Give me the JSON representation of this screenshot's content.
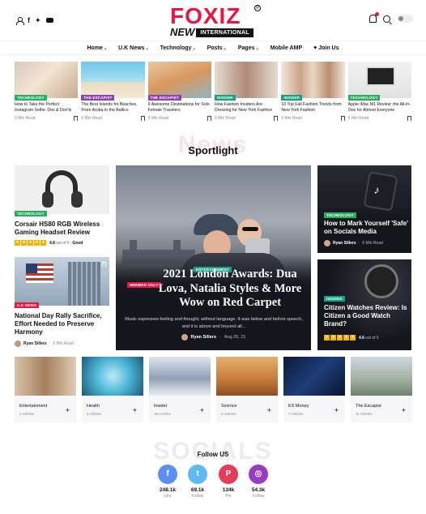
{
  "header": {
    "logo_main": "FOXIZ",
    "logo_new": "NEW",
    "logo_international": "INTERNATIONAL",
    "social_icons": [
      "facebook-icon",
      "twitter-icon",
      "youtube-icon"
    ]
  },
  "nav": [
    {
      "label": "Home",
      "has_dropdown": true
    },
    {
      "label": "U.K News",
      "has_dropdown": true
    },
    {
      "label": "Technology",
      "has_dropdown": true
    },
    {
      "label": "Posts",
      "has_dropdown": true
    },
    {
      "label": "Pages",
      "has_dropdown": true
    },
    {
      "label": "Mobile AMP",
      "has_dropdown": false
    },
    {
      "label": "Join Us",
      "has_dropdown": false
    }
  ],
  "strip": [
    {
      "tag": "TECHNOLOGY",
      "tag_color": "#27ae60",
      "title": "How to Take the Perfect Instagram Selfie: Dos & Don'ts",
      "read": "6 Min Read"
    },
    {
      "tag": "THE ESCAPIST",
      "tag_color": "#8e44ad",
      "title": "The Best Islands for Beaches, From Aruba to the Baltics",
      "read": "6 Min Read"
    },
    {
      "tag": "THE ESCAPIST",
      "tag_color": "#8e44ad",
      "title": "9 Awesome Destinations for Solo Female Travelers",
      "read": "6 Min Read"
    },
    {
      "tag": "INSIDER",
      "tag_color": "#16a085",
      "title": "How Fashion Insiders Are Dressing for New York Fashion Week",
      "read": "6 Min Read"
    },
    {
      "tag": "INSIDER",
      "tag_color": "#16a085",
      "title": "10 Top Fall Fashion Trends from New York Fashion",
      "read": "6 Min Read"
    },
    {
      "tag": "TECHNOLOGY",
      "tag_color": "#27ae60",
      "title": "Apple iMac M1 Review: the All-in-One for Almost Everyone",
      "read": "6 Min Read"
    }
  ],
  "sportlight": {
    "ghost": "News",
    "title": "Sportlight",
    "left_top": {
      "tag": "TECHNOLOGY",
      "tag_color": "#27ae60",
      "title": "Corsair HS80 RGB Wireless Gaming Headset Review",
      "rating": "4.8",
      "rating_suffix": "out of 5",
      "verdict": "Good"
    },
    "left_bottom": {
      "tag": "U.K NEWS",
      "tag_color": "#e8173f",
      "title": "National Day Rally Sacrifice, Effort Needed to Preserve Harmony",
      "author": "Ryan Sillers",
      "read": "6 Min Read"
    },
    "feature": {
      "tag_member": "MEMBER ONLY",
      "tag_cat": "ENTERTAINMENT",
      "title": "2021 London Awards: Dua Lova, Natalia Styles & More Wow on Red Carpet",
      "excerpt": "Music expresses feeling and thought, without language. It was below and before speech, and it is above and beyond all...",
      "author": "Ryan Sillers",
      "date": "Aug 26, 21"
    },
    "right_top": {
      "tag": "TECHNOLOGY",
      "tag_color": "#27ae60",
      "title": "How to Mark Yourself 'Safe' on Socials Media",
      "author": "Ryan Sillers",
      "read": "6 Min Read"
    },
    "right_bottom": {
      "tag": "INSIDER",
      "tag_color": "#16a085",
      "title": "Citizen Watches Review: Is Citizen a Good Watch Brand?",
      "rating": "4.6",
      "rating_suffix": "out of 5"
    }
  },
  "categories": [
    {
      "name": "Entertainment",
      "count": "4 Articles"
    },
    {
      "name": "Health",
      "count": "6 Articles"
    },
    {
      "name": "Insider",
      "count": "16 Articles"
    },
    {
      "name": "Science",
      "count": "4 Articles"
    },
    {
      "name": "ES Money",
      "count": "7 Articles"
    },
    {
      "name": "The Escapist",
      "count": "11 Articles"
    }
  ],
  "socials": {
    "ghost": "SOCIALS",
    "title": "Follow US",
    "items": [
      {
        "icon": "facebook-icon",
        "glyph": "f",
        "color": "#5b8ff0",
        "count": "248.1k",
        "label": "Like"
      },
      {
        "icon": "twitter-icon",
        "glyph": "t",
        "color": "#5fb8f0",
        "count": "69.1k",
        "label": "Follow"
      },
      {
        "icon": "pinterest-icon",
        "glyph": "P",
        "color": "#e63c57",
        "count": "134k",
        "label": "Pin"
      },
      {
        "icon": "instagram-icon",
        "glyph": "◎",
        "color": "#9a3bc4",
        "count": "54.3k",
        "label": "Follow"
      }
    ]
  }
}
